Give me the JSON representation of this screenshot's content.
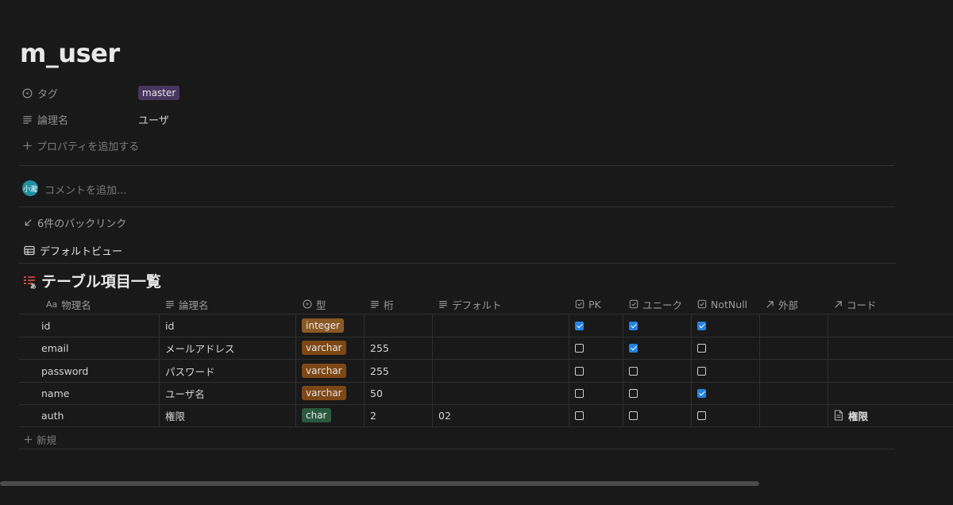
{
  "page": {
    "title": "m_user",
    "properties": [
      {
        "label": "タグ",
        "icon": "tag-select-icon",
        "value": "master",
        "tag_color": "#483660"
      },
      {
        "label": "論理名",
        "icon": "text-lines-icon",
        "value": "ユーザ"
      }
    ],
    "add_property": "プロパティを追加する",
    "avatar_text": "小瀧",
    "comment_placeholder": "コメントを追加...",
    "backlinks": "6件のバックリンク",
    "view_name": "デフォルトビュー",
    "database_title": "テーブル項目一覧",
    "new_row_label": "新規"
  },
  "table": {
    "columns": [
      {
        "label": "物理名",
        "icon": "Aa"
      },
      {
        "label": "論理名",
        "icon": "text-lines-icon"
      },
      {
        "label": "型",
        "icon": "select-icon"
      },
      {
        "label": "桁",
        "icon": "text-lines-icon"
      },
      {
        "label": "デフォルト",
        "icon": "text-lines-icon"
      },
      {
        "label": "PK",
        "icon": "checkbox-icon"
      },
      {
        "label": "ユニーク",
        "icon": "checkbox-icon"
      },
      {
        "label": "NotNull",
        "icon": "checkbox-icon"
      },
      {
        "label": "外部",
        "icon": "relation-arrow-icon"
      },
      {
        "label": "コード",
        "icon": "relation-arrow-icon"
      }
    ],
    "rows": [
      {
        "physical": "id",
        "logical": "id",
        "type": "integer",
        "type_color": "#8a5a25",
        "digits": "",
        "default": "",
        "pk": true,
        "unique": true,
        "notnull": true,
        "fk": "",
        "code": ""
      },
      {
        "physical": "email",
        "logical": "メールアドレス",
        "type": "varchar",
        "type_color": "#7d4716",
        "digits": "255",
        "default": "",
        "pk": false,
        "unique": true,
        "notnull": false,
        "fk": "",
        "code": ""
      },
      {
        "physical": "password",
        "logical": "パスワード",
        "type": "varchar",
        "type_color": "#7d4716",
        "digits": "255",
        "default": "",
        "pk": false,
        "unique": false,
        "notnull": false,
        "fk": "",
        "code": ""
      },
      {
        "physical": "name",
        "logical": "ユーザ名",
        "type": "varchar",
        "type_color": "#7d4716",
        "digits": "50",
        "default": "",
        "pk": false,
        "unique": false,
        "notnull": true,
        "fk": "",
        "code": ""
      },
      {
        "physical": "auth",
        "logical": "権限",
        "type": "char",
        "type_color": "#2b593f",
        "digits": "2",
        "default": "02",
        "pk": false,
        "unique": false,
        "notnull": false,
        "fk": "",
        "code": "権限"
      }
    ]
  }
}
